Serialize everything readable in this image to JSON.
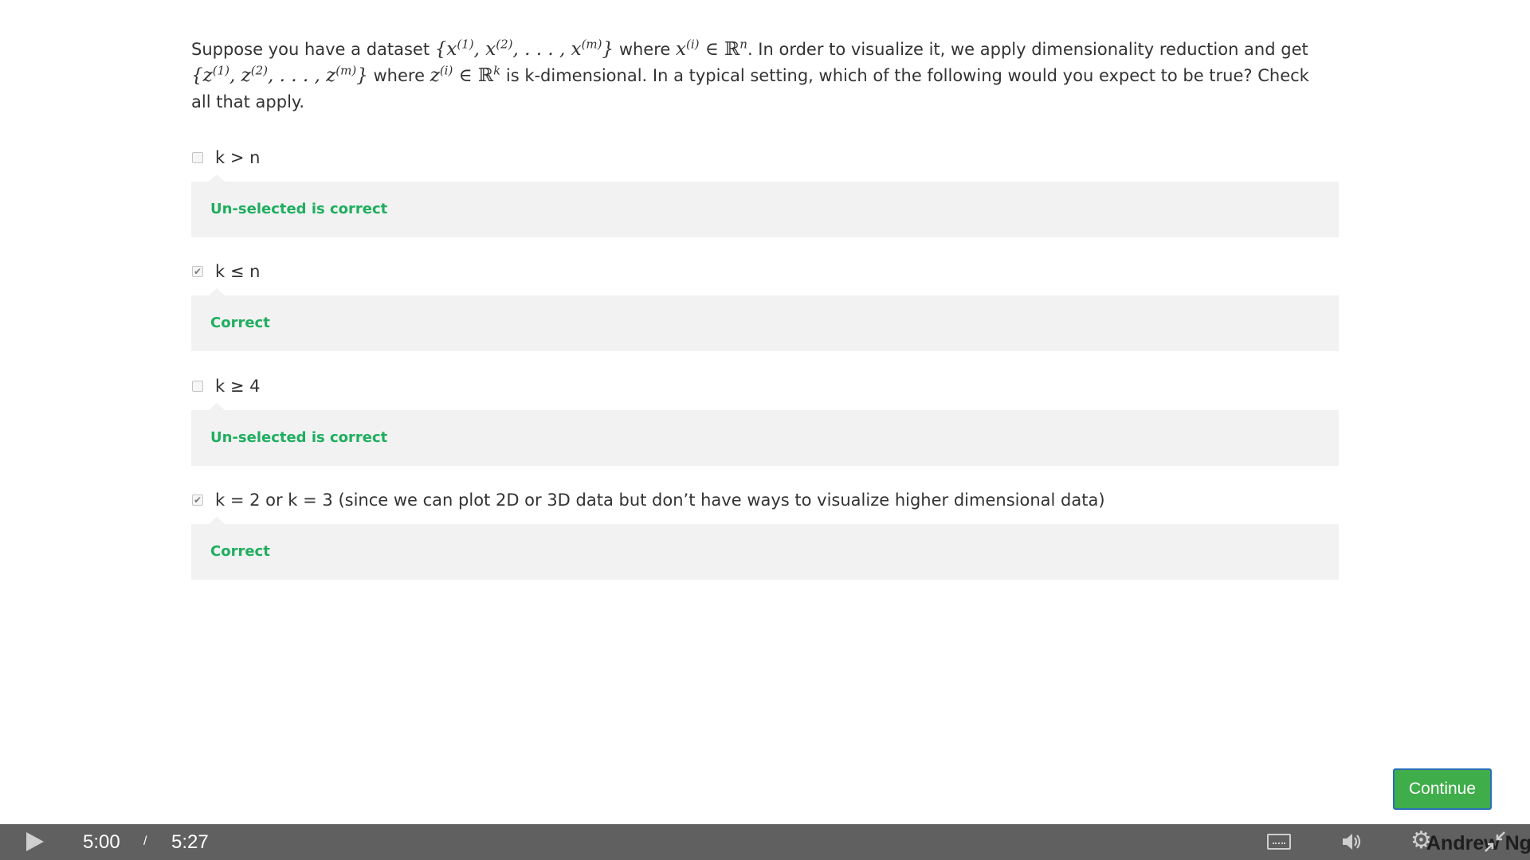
{
  "question": {
    "t1": "Suppose you have a dataset ",
    "t2": " where ",
    "t3": ". In order to visualize it, we apply dimensionality reduction and get",
    "t4": " where ",
    "t5": " is k-dimensional. In a typical setting, which of the following would you expect to be true? Check all that apply."
  },
  "options": [
    {
      "label": "k > n",
      "checked": false,
      "feedback": "Un-selected is correct"
    },
    {
      "label": "k ≤ n",
      "checked": true,
      "feedback": "Correct"
    },
    {
      "label": "k ≥ 4",
      "checked": false,
      "feedback": "Un-selected is correct"
    },
    {
      "label": "k = 2 or k = 3 (since we can plot 2D or 3D data but don’t have ways to visualize higher dimensional data)",
      "checked": true,
      "feedback": "Correct"
    }
  ],
  "continue_label": "Continue",
  "player": {
    "current_time": "5:00",
    "separator": "/",
    "total_time": "5:27",
    "watermark": "Andrew Ng"
  },
  "colors": {
    "correct": "#1fae5f",
    "continue_bg": "#3fad4a",
    "player_bg": "#606060"
  },
  "icons": [
    "play-icon",
    "captions-icon",
    "volume-icon",
    "gear-icon",
    "fullscreen-exit-icon"
  ]
}
